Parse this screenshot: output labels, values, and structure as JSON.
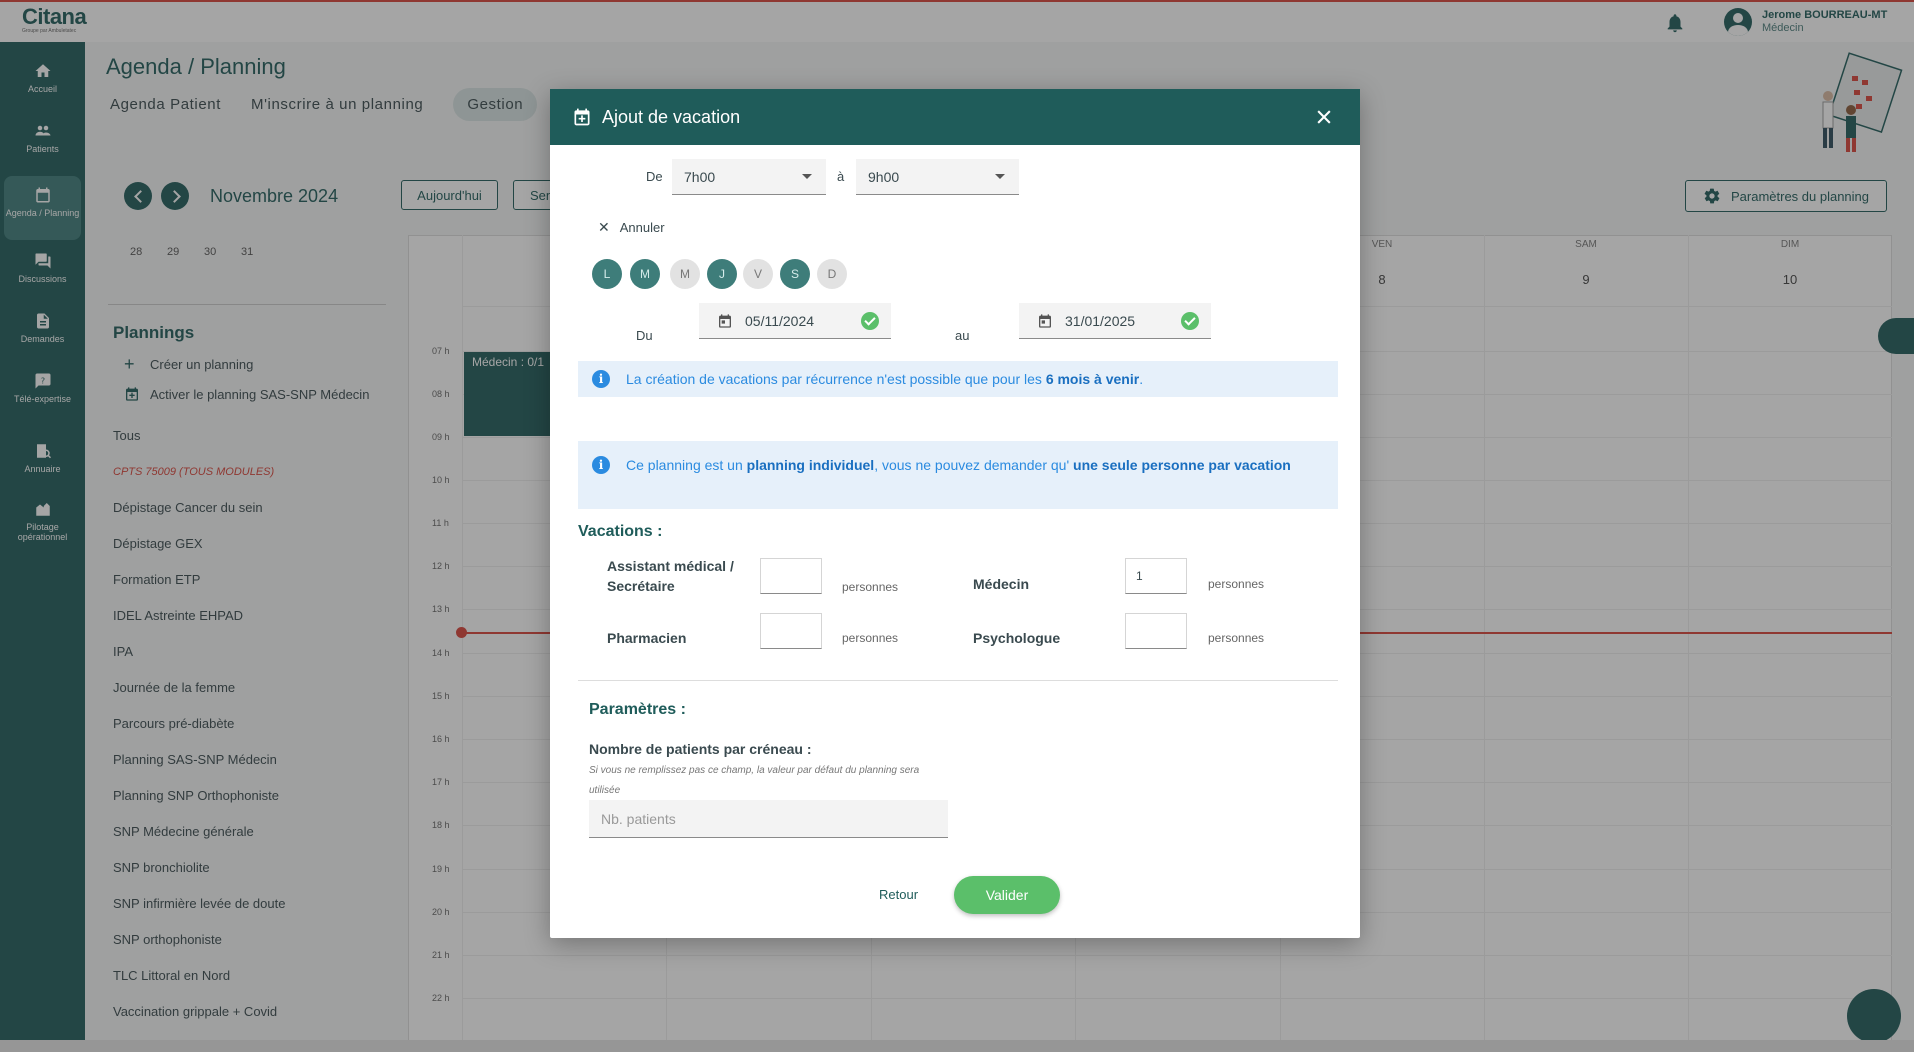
{
  "header": {
    "logo_text": "Citana",
    "logo_sub": "Groupe par Ambuletatec",
    "user_name": "Jerome BOURREAU-MT",
    "user_role": "Médecin"
  },
  "sidebar": {
    "items": [
      {
        "label": "Accueil",
        "icon": "home-icon"
      },
      {
        "label": "Patients",
        "icon": "people-icon"
      },
      {
        "label": "Agenda / Planning",
        "icon": "calendar-icon",
        "active": true
      },
      {
        "label": "Discussions",
        "icon": "chat-icon"
      },
      {
        "label": "Demandes",
        "icon": "document-icon"
      },
      {
        "label": "Télé-expertise",
        "icon": "question-icon"
      },
      {
        "label": "Annuaire",
        "icon": "directory-icon"
      },
      {
        "label": "Pilotage opérationnel",
        "icon": "pilot-icon"
      }
    ]
  },
  "page": {
    "title": "Agenda / Planning",
    "tabs": [
      "Agenda Patient",
      "M'inscrire à un planning",
      "Gestion"
    ],
    "month": "Novembre 2024",
    "today_button": "Aujourd'hui",
    "second_button": "Sem",
    "params_button": "Paramètres du planning",
    "mini_days": [
      "28",
      "29",
      "30",
      "31"
    ],
    "plannings_title": "Plannings",
    "create_planning": "Créer un planning",
    "activate_planning": "Activer le planning SAS-SNP Médecin",
    "planning_list": [
      "Tous",
      "CPTS 75009 (TOUS MODULES)",
      "Dépistage Cancer du sein",
      "Dépistage GEX",
      "Formation ETP",
      "IDEL Astreinte EHPAD",
      "IPA",
      "Journée de la femme",
      "Parcours pré-diabète",
      "Planning SAS-SNP Médecin",
      "Planning SNP Orthophoniste",
      "SNP Médecine générale",
      "SNP bronchiolite",
      "SNP infirmière levée de doute",
      "SNP orthophoniste",
      "TLC Littoral en Nord",
      "Vaccination grippale + Covid"
    ],
    "calendar": {
      "hours": [
        "07 h",
        "08 h",
        "09 h",
        "10 h",
        "11 h",
        "12 h",
        "13 h",
        "14 h",
        "15 h",
        "16 h",
        "17 h",
        "18 h",
        "19 h",
        "20 h",
        "21 h",
        "22 h"
      ],
      "days": [
        {
          "name": "VEN",
          "num": "8"
        },
        {
          "name": "SAM",
          "num": "9"
        },
        {
          "name": "DIM",
          "num": "10"
        }
      ],
      "event_label": "Médecin : 0/1"
    }
  },
  "modal": {
    "title": "Ajout de vacation",
    "from_label": "De",
    "from_value": "7h00",
    "to_label": "à",
    "to_value": "9h00",
    "cancel_label": "Annuler",
    "weekdays": [
      {
        "label": "L",
        "selected": true
      },
      {
        "label": "M",
        "selected": true
      },
      {
        "label": "M",
        "selected": false
      },
      {
        "label": "J",
        "selected": true
      },
      {
        "label": "V",
        "selected": false
      },
      {
        "label": "S",
        "selected": true
      },
      {
        "label": "D",
        "selected": false
      }
    ],
    "du_label": "Du",
    "du_value": "05/11/2024",
    "au_label": "au",
    "au_value": "31/01/2025",
    "info1_pre": "La création de vacations par récurrence n'est possible que pour les ",
    "info1_bold": "6 mois à venir",
    "info1_post": ".",
    "info2_pre": "Ce planning est un ",
    "info2_bold1": "planning individuel",
    "info2_mid": ", vous ne pouvez demander qu' ",
    "info2_bold2": "une seule personne par vacation",
    "vacations_title": "Vacations :",
    "roles": [
      {
        "label": "Assistant médical / Secrétaire",
        "value": "",
        "unit": "personnes"
      },
      {
        "label": "Médecin",
        "value": "1",
        "unit": "personnes"
      },
      {
        "label": "Pharmacien",
        "value": "",
        "unit": "personnes"
      },
      {
        "label": "Psychologue",
        "value": "",
        "unit": "personnes"
      }
    ],
    "params_title": "Paramètres :",
    "patients_label": "Nombre de patients par créneau :",
    "patients_hint": "Si vous ne remplissez pas ce champ, la valeur par défaut du planning sera utilisée",
    "patients_placeholder": "Nb. patients",
    "back_label": "Retour",
    "submit_label": "Valider"
  },
  "colors": {
    "primary": "#1f5c5a",
    "accent_green": "#5bbf6a",
    "info_blue": "#2b8be0",
    "alert_red": "#d9443a"
  }
}
